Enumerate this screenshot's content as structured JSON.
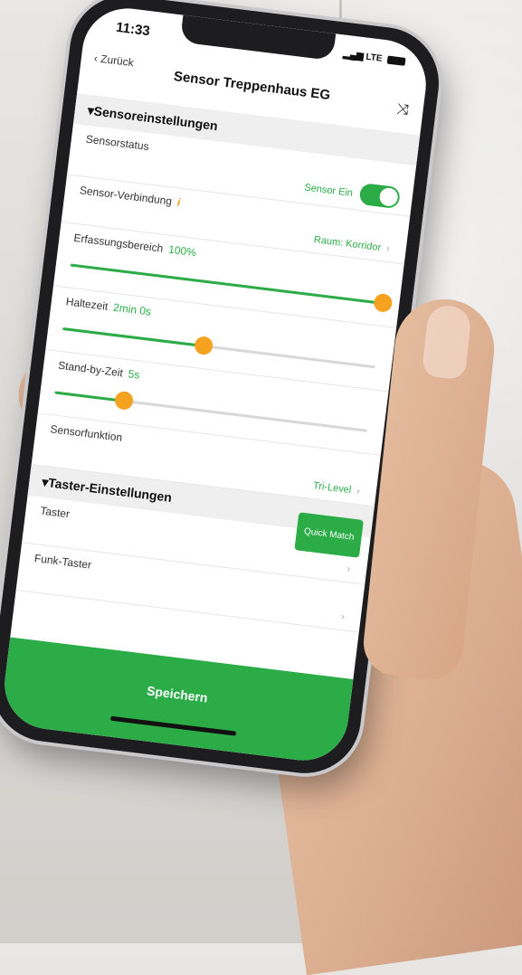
{
  "status_bar": {
    "time": "11:33",
    "network": "LTE"
  },
  "nav": {
    "back_label": "Zurück",
    "title": "Sensor Treppenhaus EG",
    "shuffle_icon": "shuffle-icon"
  },
  "sections": {
    "sensor": "Sensoreinstellungen",
    "taster": "Taster-Einstellungen"
  },
  "rows": {
    "sensorstatus": {
      "label": "Sensorstatus",
      "value": "Sensor Ein",
      "toggle_on": true
    },
    "verbindung": {
      "label": "Sensor-Verbindung",
      "info_icon": "i",
      "value": "Raum: Korridor"
    },
    "erfassung": {
      "label": "Erfassungsbereich",
      "value": "100%",
      "level": 1.0
    },
    "haltezeit": {
      "label": "Haltezeit",
      "value": "2min 0s",
      "level": 0.45
    },
    "standby": {
      "label": "Stand-by-Zeit",
      "value": "5s",
      "level": 0.22
    },
    "funktion": {
      "label": "Sensorfunktion",
      "value": "Tri-Level"
    },
    "taster": {
      "label": "Taster",
      "button": "Quick Match"
    },
    "funk": {
      "label": "Funk-Taster"
    }
  },
  "save_label": "Speichern",
  "colors": {
    "accent": "#2bac46",
    "slider_thumb": "#f4a21f",
    "info": "#f39c1e"
  }
}
